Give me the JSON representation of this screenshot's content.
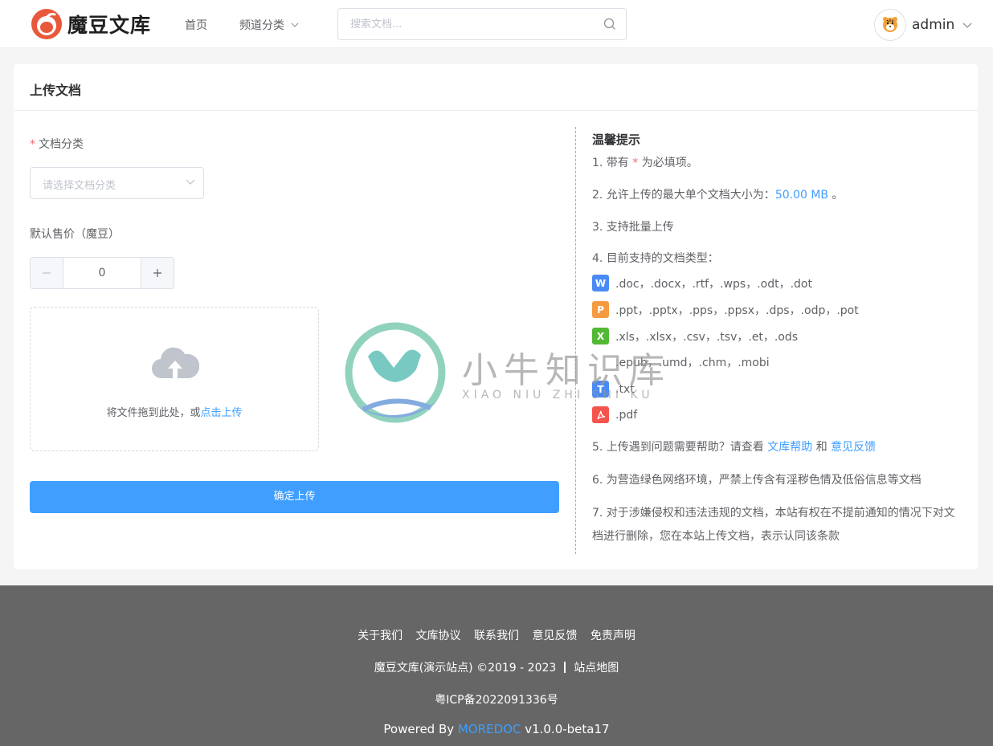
{
  "header": {
    "logo_text": "魔豆文库",
    "nav_home": "首页",
    "nav_channel": "频道分类",
    "search_placeholder": "搜索文档...",
    "username": "admin"
  },
  "card": {
    "title": "上传文档",
    "category_required": "*",
    "category_label": "文档分类",
    "category_placeholder": "请选择文档分类",
    "price_label": "默认售价（魔豆）",
    "price_value": "0",
    "drop_text": "将文件拖到此处，或",
    "drop_link": "点击上传",
    "submit_label": "确定上传"
  },
  "tips": {
    "title": "温馨提示",
    "t1_pre": "1. 带有",
    "t1_star": "*",
    "t1_post": "为必填项。",
    "t2_pre": "2. 允许上传的最大单个文档大小为：",
    "t2_size": "50.00 MB",
    "t2_post": "。",
    "t3": "3. 支持批量上传",
    "t4": "4. 目前支持的文档类型：",
    "file_types": [
      {
        "icon": "W",
        "color": "#4a8af4",
        "text": ".doc，.docx，.rtf，.wps，.odt，.dot"
      },
      {
        "icon": "P",
        "color": "#f59a40",
        "text": ".ppt，.pptx，.pps，.ppsx，.dps，.odp，.pot"
      },
      {
        "icon": "X",
        "color": "#52b934",
        "text": ".xls，.xlsx，.csv，.tsv，.et，.ods"
      },
      {
        "icon": "",
        "color": "#ffffff",
        "text": ".epub，.umd，.chm，.mobi"
      },
      {
        "icon": "T",
        "color": "#4a8af4",
        "text": ".txt"
      },
      {
        "icon": "PDF",
        "color": "#f5544d",
        "text": ".pdf"
      }
    ],
    "t5_pre": "5. 上传遇到问题需要帮助？请查看",
    "t5_link1": "文库帮助",
    "t5_and": "和",
    "t5_link2": "意见反馈",
    "t6": "6. 为营造绿色网络环境，严禁上传含有淫秽色情及低俗信息等文档",
    "t7": "7. 对于涉嫌侵权和违法违规的文档，本站有权在不提前通知的情况下对文档进行删除，您在本站上传文档，表示认同该条款"
  },
  "watermark": {
    "text": "小牛知识库",
    "sub": "XIAO NIU ZHI SHI KU"
  },
  "footer": {
    "links": [
      "关于我们",
      "文库协议",
      "联系我们",
      "意见反馈",
      "免责声明"
    ],
    "copyright": "魔豆文库(演示站点) ©2019 - 2023",
    "sitemap": "站点地图",
    "icp": "粤ICP备2022091336号",
    "powered_pre": "Powered By",
    "powered_brand": "MOREDOC",
    "powered_version": "v1.0.0-beta17"
  }
}
